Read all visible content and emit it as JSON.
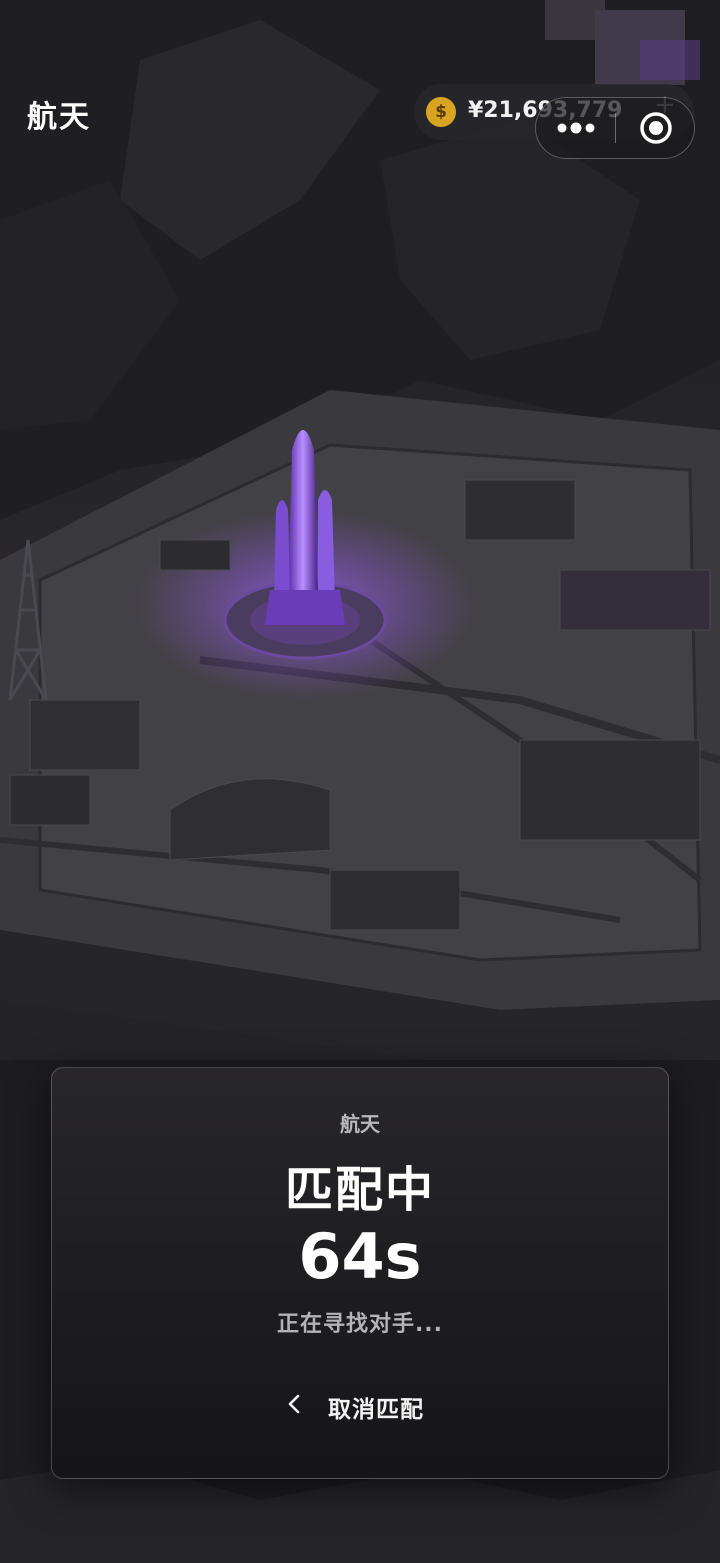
{
  "header": {
    "title": "航天",
    "currency_icon": "dollar-coin-icon",
    "balance": "¥21,693,779",
    "add_symbol": "+"
  },
  "capsule": {
    "more_icon": "more-dots-icon",
    "close_icon": "target-icon"
  },
  "match_card": {
    "mode": "航天",
    "status": "匹配中",
    "timer": "64s",
    "hint": "正在寻找对手...",
    "cancel_label": "取消匹配",
    "cancel_icon": "chevron-left-icon"
  },
  "colors": {
    "accent_purple": "#7a3fd0",
    "coin_gold": "#d9a520",
    "card_bg": "#1f1f22"
  }
}
